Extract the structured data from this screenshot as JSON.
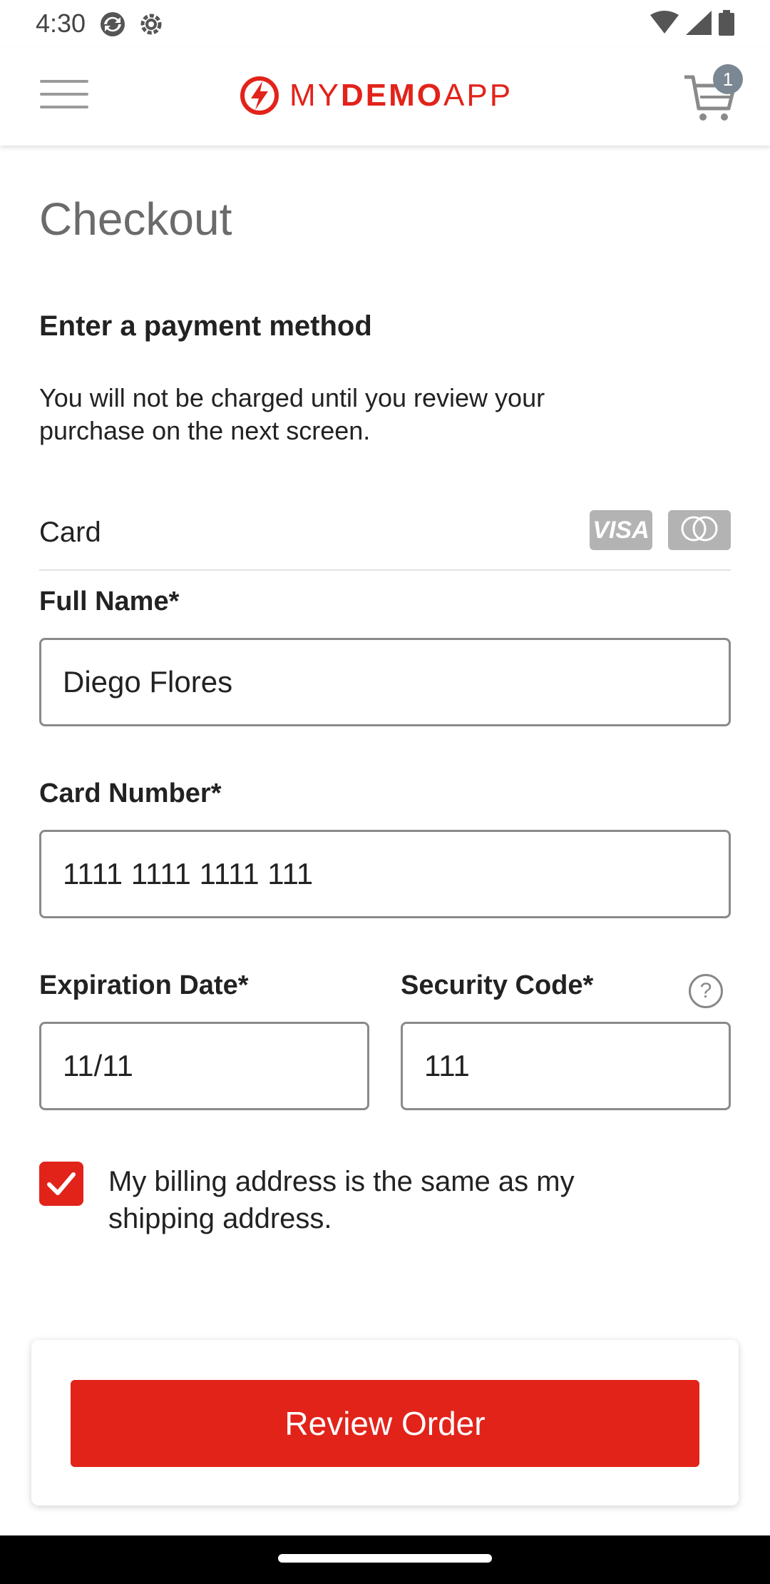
{
  "status_bar": {
    "time": "4:30",
    "left_icons": [
      "sync-icon",
      "settings-gear-icon"
    ],
    "right_icons": [
      "wifi-icon",
      "signal-icon",
      "battery-icon"
    ]
  },
  "header": {
    "logo": {
      "prefix": "MY",
      "bold": "DEMO",
      "suffix": "APP"
    },
    "cart_count": "1"
  },
  "page": {
    "title": "Checkout",
    "section_title": "Enter a payment method",
    "description": "You will not be charged until you review your purchase on the next screen."
  },
  "payment": {
    "card_label": "Card",
    "visa_label": "VISA",
    "full_name_label": "Full Name*",
    "full_name_value": "Diego Flores",
    "card_number_label": "Card Number*",
    "card_number_value": "1111 1111 1111 111",
    "expiration_label": "Expiration Date*",
    "expiration_value": "11/11",
    "security_label": "Security Code*",
    "security_value": "111",
    "help_symbol": "?",
    "billing_same_text": "My billing address is the same as my shipping address.",
    "billing_same_checked": true
  },
  "footer": {
    "review_button_label": "Review Order"
  },
  "colors": {
    "accent": "#e2231a",
    "title_gray": "#6b6b6b",
    "badge": "#7b8792",
    "card_logo_gray": "#b3b3b3"
  }
}
